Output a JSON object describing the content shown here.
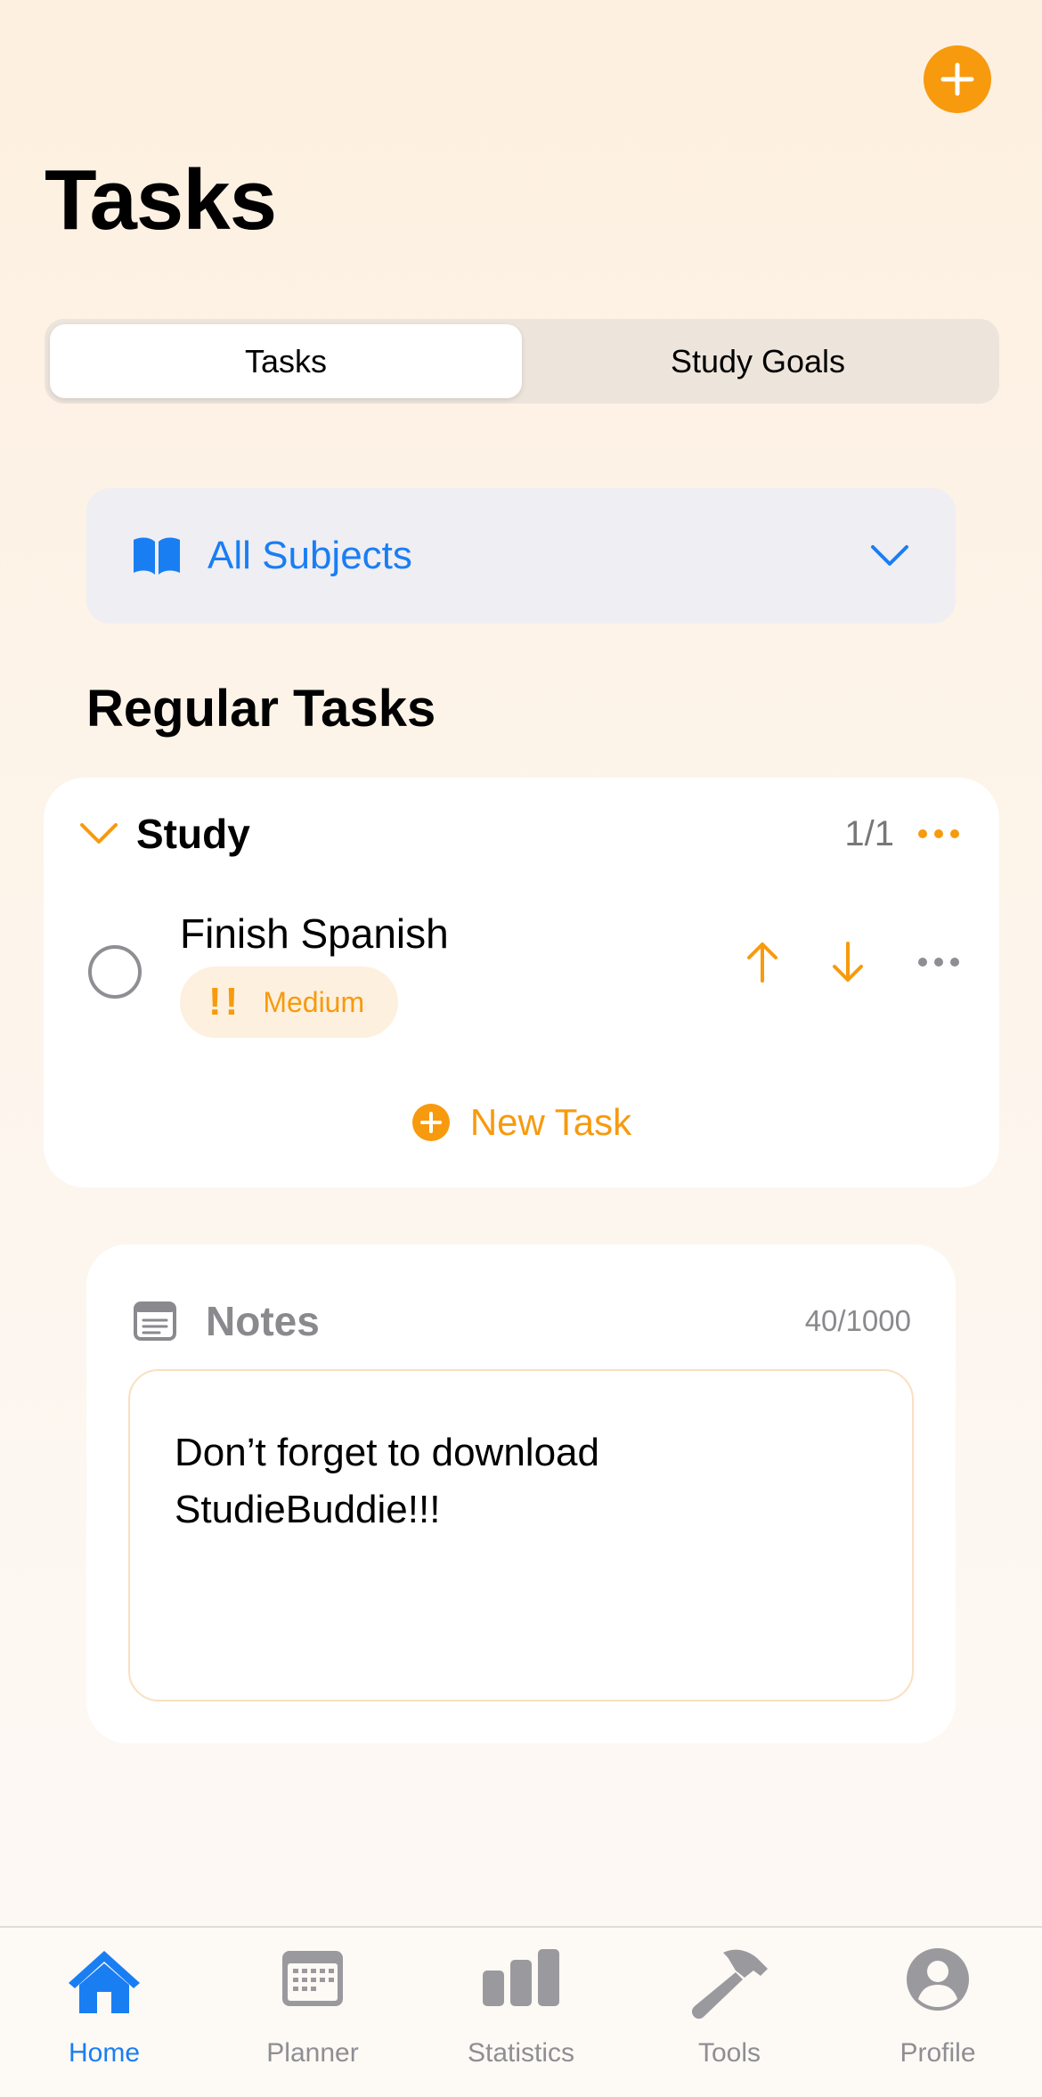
{
  "header": {
    "title": "Tasks",
    "add_icon": "plus-icon"
  },
  "segments": {
    "items": [
      {
        "label": "Tasks",
        "active": true
      },
      {
        "label": "Study Goals",
        "active": false
      }
    ]
  },
  "subject_filter": {
    "label": "All Subjects",
    "icon": "book-icon"
  },
  "regular_tasks": {
    "title": "Regular Tasks",
    "group": {
      "name": "Study",
      "count": "1/1",
      "tasks": [
        {
          "name": "Finish Spanish",
          "priority_symbol": "!!",
          "priority_label": "Medium",
          "completed": false
        }
      ],
      "new_task_label": "New Task"
    }
  },
  "notes": {
    "title": "Notes",
    "count": "40/1000",
    "text": "Don’t forget to download StudieBuddie!!!"
  },
  "tabbar": {
    "items": [
      {
        "label": "Home",
        "icon": "home-icon",
        "active": true
      },
      {
        "label": "Planner",
        "icon": "calendar-icon",
        "active": false
      },
      {
        "label": "Statistics",
        "icon": "bar-chart-icon",
        "active": false
      },
      {
        "label": "Tools",
        "icon": "hammer-icon",
        "active": false
      },
      {
        "label": "Profile",
        "icon": "person-icon",
        "active": false
      }
    ]
  },
  "colors": {
    "accent": "#f79a0e",
    "link": "#1a7ef3",
    "muted": "#8e8e93"
  }
}
